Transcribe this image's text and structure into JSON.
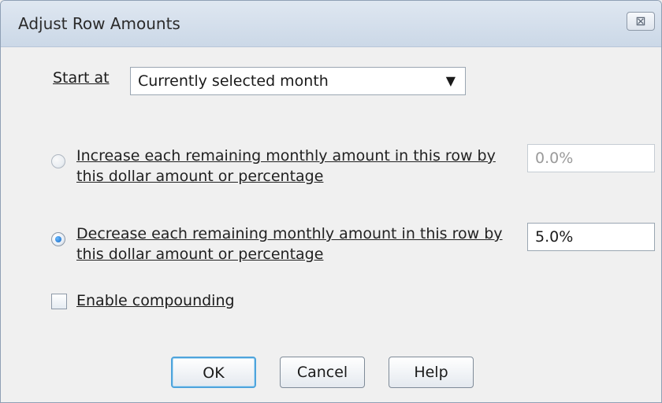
{
  "dialog": {
    "title": "Adjust Row Amounts",
    "close_glyph": "⊠"
  },
  "start_at": {
    "label": "Start at",
    "selected": "Currently selected month",
    "arrow": "▼"
  },
  "options": [
    {
      "line1": "Increase each remaining monthly amount in this row by",
      "line2": "this dollar amount or percentage",
      "value": "0.0%",
      "selected": false
    },
    {
      "line1": "Decrease each remaining monthly amount in this row by",
      "line2": "this dollar amount or percentage",
      "value": "5.0%",
      "selected": true
    }
  ],
  "compounding": {
    "label": "Enable compounding",
    "checked": false
  },
  "buttons": {
    "ok": "OK",
    "cancel": "Cancel",
    "help": "Help"
  }
}
